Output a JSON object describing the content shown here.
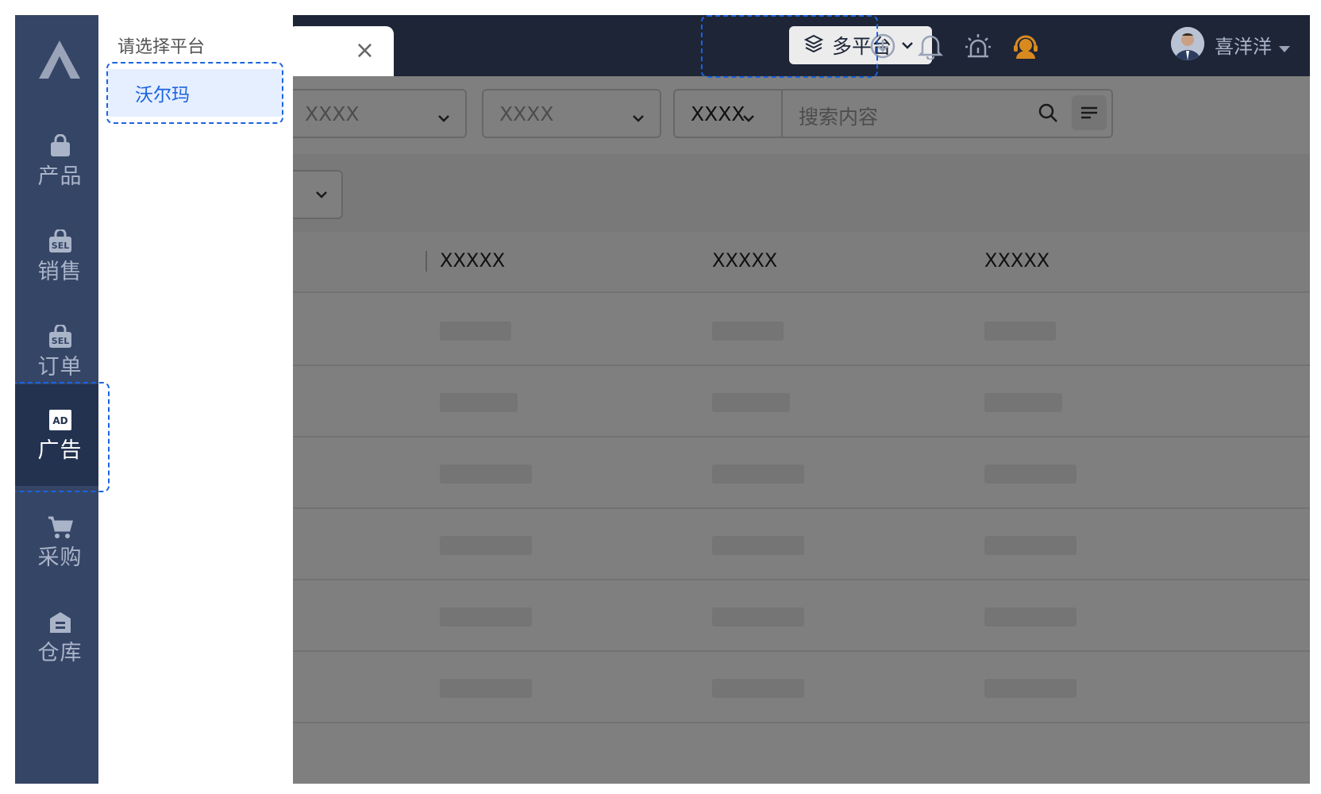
{
  "sidebar": {
    "items": [
      {
        "label": "产品",
        "icon": "bag-icon"
      },
      {
        "label": "销售",
        "icon": "sel-bag-icon"
      },
      {
        "label": "订单",
        "icon": "sel-bag-icon"
      },
      {
        "label": "广告",
        "icon": "ad-icon",
        "active": true
      },
      {
        "label": "采购",
        "icon": "cart-icon"
      },
      {
        "label": "仓库",
        "icon": "warehouse-icon"
      }
    ]
  },
  "header": {
    "platform_label": "多平台",
    "user_name": "喜洋洋",
    "tab_close": "×"
  },
  "filters": {
    "select1": "XXXX",
    "select2": "XXXX",
    "select3": "XXXX",
    "search_placeholder": "搜索内容"
  },
  "table": {
    "columns": [
      "XXXXX",
      "XXXXX",
      "XXXXX"
    ]
  },
  "platform_panel": {
    "title": "请选择平台",
    "item": "沃尔玛"
  },
  "colors": {
    "sidebar": "#354566",
    "header": "#1e2537",
    "accent": "#1a64e0"
  }
}
